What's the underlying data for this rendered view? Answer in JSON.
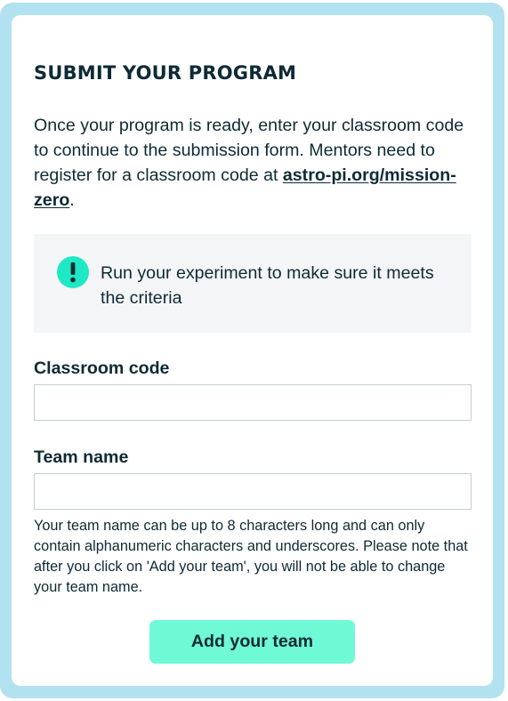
{
  "form": {
    "title": "SUBMIT YOUR PROGRAM",
    "intro_text": "Once your program is ready, enter your classroom code to continue to the submission form. Mentors need to register for a classroom code at ",
    "intro_link": "astro-pi.org/mission-zero",
    "intro_end": ".",
    "notice": {
      "icon": "exclamation-icon",
      "text": "Run your experiment to make sure it meets the criteria"
    },
    "classroom_code": {
      "label": "Classroom code",
      "value": "",
      "placeholder": ""
    },
    "team_name": {
      "label": "Team name",
      "value": "",
      "placeholder": "",
      "hint": "Your team name can be up to 8 characters long and can only contain alphanumeric characters and underscores. Please note that after you click on 'Add your team', you will not be able to change your team name."
    },
    "submit_label": "Add your team"
  },
  "colors": {
    "frame": "#b2e2ef",
    "text": "#0e2a35",
    "notice_bg": "#f4f5f7",
    "accent": "#6ff9d5",
    "icon_bg": "#1fe8c4",
    "field_border": "#c8ccd0"
  }
}
